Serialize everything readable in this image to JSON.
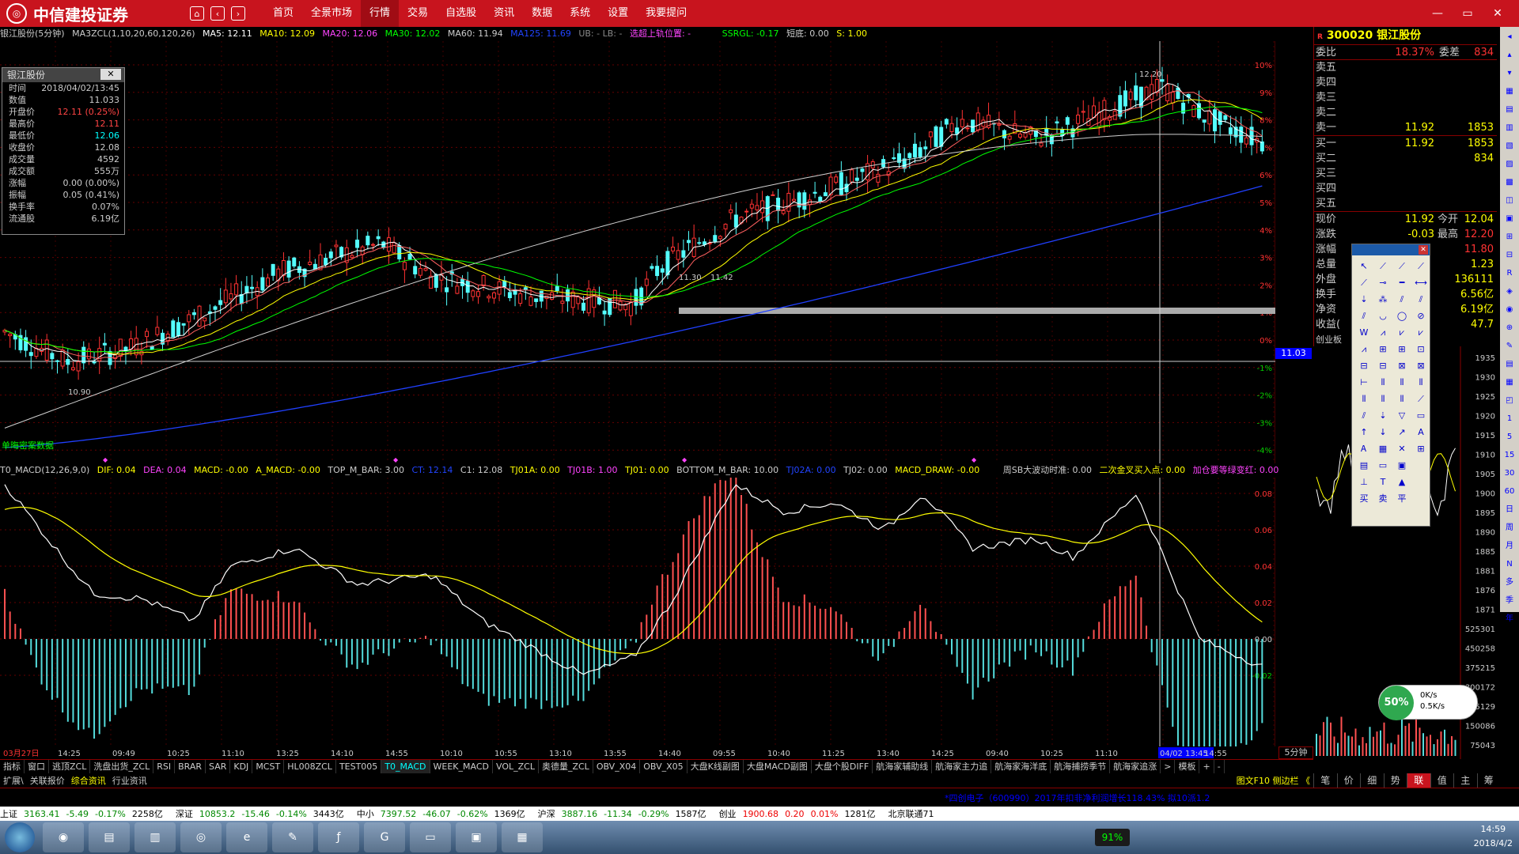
{
  "app": {
    "brand": "中信建投证券",
    "menu": [
      "首页",
      "全景市场",
      "行情",
      "交易",
      "自选股",
      "资讯",
      "数据",
      "系统",
      "设置",
      "我要提问"
    ],
    "active_menu": "行情",
    "window_controls": [
      "—",
      "▭",
      "✕"
    ]
  },
  "stock": {
    "code": "300020",
    "name": "银江股份",
    "period_title": "银江股份(5分钟)",
    "ma_params": "MA3ZCL(1,10,20,60,120,26)",
    "ma5": "MA5: 12.11",
    "ma10": "MA10: 12.09",
    "ma20": "MA20: 12.06",
    "ma30": "MA30: 12.02",
    "ma60": "MA60: 11.94",
    "ma125": "MA125: 11.69",
    "ub_lb": "UB: - LB: -",
    "pressure": "选超上轨位置: -",
    "ssrgl": "SSRGL: -0.17",
    "short": "短底: 0.00",
    "s": "S: 1.00",
    "zero_left": "0",
    "zero_right": "0"
  },
  "macd_line": {
    "title": "T0_MACD(12,26,9,0)",
    "dif": "DIF: 0.04",
    "dea": "DEA: 0.04",
    "macd": "MACD: -0.00",
    "a_macd": "A_MACD: -0.00",
    "top_bar": "TOP_M_BAR: 3.00",
    "ct": "CT: 12.14",
    "c1": "C1: 12.08",
    "tj01a": "TJ01A: 0.00",
    "tj01b": "TJ01B: 1.00",
    "tj01": "TJ01: 0.00",
    "bottom_bar": "BOTTOM_M_BAR: 10.00",
    "tj02a": "TJ02A: 0.00",
    "tj02": "TJ02: 0.00",
    "macd_draw": "MACD_DRAW: -0.00",
    "zhou": "周SB大波动时准: 0.00",
    "erci": "二次金叉买入点: 0.00",
    "jiacang": "加仓要等绿变红: 0.00"
  },
  "info_box": {
    "title": "银江股份",
    "rows": [
      {
        "k": "时间",
        "v": "2018/04/02/13:45",
        "c": "#ccc"
      },
      {
        "k": "数值",
        "v": "11.033",
        "c": "#ccc"
      },
      {
        "k": "开盘价",
        "v": "12.11 (0.25%)",
        "c": "#f44"
      },
      {
        "k": "最高价",
        "v": "12.11",
        "c": "#f44"
      },
      {
        "k": "最低价",
        "v": "12.06",
        "c": "#0ff"
      },
      {
        "k": "收盘价",
        "v": "12.08",
        "c": "#ccc"
      },
      {
        "k": "成交量",
        "v": "4592",
        "c": "#ccc"
      },
      {
        "k": "成交额",
        "v": "555万",
        "c": "#ccc"
      },
      {
        "k": "涨幅",
        "v": "0.00 (0.00%)",
        "c": "#ccc"
      },
      {
        "k": "振幅",
        "v": "0.05 (0.41%)",
        "c": "#ccc"
      },
      {
        "k": "换手率",
        "v": "0.07%",
        "c": "#ccc"
      },
      {
        "k": "流通股",
        "v": "6.19亿",
        "c": "#ccc"
      }
    ]
  },
  "order_book": {
    "weibi_label": "委比",
    "weibi": "18.37%",
    "weicha_label": "委差",
    "weicha": "834",
    "sells": [
      "卖五",
      "卖四",
      "卖三",
      "卖二",
      "卖一"
    ],
    "sell1_price": "11.92",
    "sell1_vol": "1853",
    "buys": [
      "买一",
      "买二",
      "买三",
      "买四",
      "买五"
    ],
    "buy1_price": "11.92",
    "buy1_vol": "1853",
    "buy2_vol": "834",
    "quote": [
      {
        "l": "现价",
        "v": "11.92",
        "l2": "今开",
        "v2": "12.04"
      },
      {
        "l": "涨跌",
        "v": "-0.03",
        "l2": "最高",
        "v2": "12.20"
      },
      {
        "l": "涨幅",
        "v": "",
        "l2": "",
        "v2": "11.80"
      },
      {
        "l": "总量",
        "v": "",
        "l2": "",
        "v2": "1.23"
      },
      {
        "l": "外盘",
        "v": "",
        "l2": "",
        "v2": "136111"
      },
      {
        "l": "换手",
        "v": "",
        "l2": "",
        "v2": "6.56亿"
      },
      {
        "l": "净资",
        "v": "",
        "l2": "",
        "v2": "6.19亿"
      },
      {
        "l": "收益(",
        "v": "",
        "l2": "",
        "v2": "47.7"
      }
    ],
    "board": "创业板"
  },
  "main_axis": {
    "right_pct": [
      "10%",
      "9%",
      "8%",
      "7%",
      "6%",
      "5%",
      "4%",
      "3%",
      "2%",
      "1%",
      "0%",
      "-1%",
      "-2%",
      "-3%",
      "-4%"
    ],
    "price_tag": "11.03",
    "annotations": [
      "12.20",
      "11.30",
      "11.42",
      "10.90"
    ],
    "left_caption": "单晦密案数据"
  },
  "macd_axis": [
    "0.08",
    "0.06",
    "0.04",
    "0.02",
    "0.00",
    "-0.02"
  ],
  "time_axis": [
    "03月27日",
    "14:25",
    "09:49",
    "10:25",
    "11:10",
    "13:25",
    "14:10",
    "14:55",
    "10:10",
    "10:55",
    "13:10",
    "13:55",
    "14:40",
    "09:55",
    "10:40",
    "11:25",
    "13:40",
    "14:25",
    "09:40",
    "10:25",
    "11:10",
    "04/02 13:45",
    "14:55"
  ],
  "period_button": "5分钟",
  "right_axis": [
    "1935",
    "1930",
    "1925",
    "1920",
    "1915",
    "1910",
    "1905",
    "1900",
    "1895",
    "1890",
    "1885",
    "1881",
    "1876",
    "1871",
    "525301",
    "450258",
    "375215",
    "300172",
    "225129",
    "150086",
    "75043"
  ],
  "tabs": [
    "指标",
    "窗口",
    "逃顶ZCL",
    "洗盘出货_ZCL",
    "RSI",
    "BRAR",
    "SAR",
    "KDJ",
    "MCST",
    "HL008ZCL",
    "TEST005",
    "T0_MACD",
    "WEEK_MACD",
    "VOL_ZCL",
    "奥德量_ZCL",
    "OBV_X04",
    "OBV_X05",
    "大盘K线副图",
    "大盘MACD副图",
    "大盘个股DIFF",
    "航海家辅助线",
    "航海家主力追",
    "航海家海洋底",
    "航海捕捞季节",
    "航海家追涨",
    ">",
    "模板",
    "+",
    "-"
  ],
  "active_tab": "T0_MACD",
  "tabs2": [
    "扩展\\",
    "关联报价",
    "综合资讯",
    "行业资讯"
  ],
  "tabs2_right": "图文F10 侧边栏 《",
  "right_tabs": [
    "笔",
    "价",
    "细",
    "势",
    "联",
    "值",
    "主",
    "筹"
  ],
  "active_right_tab": "联",
  "ticker_news": "*四创电子（600990）2017年扣非净利润增长118.43% 拟10派1.2",
  "index_bar": [
    {
      "name": "上证",
      "val": "3163.41",
      "chg": "-5.49",
      "pct": "-0.17%",
      "amt": "2258亿"
    },
    {
      "name": "深证",
      "val": "10853.2",
      "chg": "-15.46",
      "pct": "-0.14%",
      "amt": "3443亿"
    },
    {
      "name": "中小",
      "val": "7397.52",
      "chg": "-46.07",
      "pct": "-0.62%",
      "amt": "1369亿"
    },
    {
      "name": "沪深",
      "val": "3887.16",
      "chg": "-11.34",
      "pct": "-0.29%",
      "amt": "1587亿"
    },
    {
      "name": "创业",
      "val": "1900.68",
      "chg": "0.20",
      "pct": "0.01%",
      "amt": "1281亿"
    }
  ],
  "broker": "北京联通71",
  "network": {
    "pct": "50%",
    "up": "0K/s",
    "down": "0.5K/s"
  },
  "battery": "91%",
  "clock": {
    "time": "14:59",
    "date": "2018/4/2"
  },
  "colors": {
    "brand": "#c8141e",
    "up": "#ff3232",
    "down": "#54ffff",
    "ma5": "#ffffff",
    "ma10": "#ffff00",
    "ma20": "#ff44ff",
    "ma30": "#00ff00",
    "ma60": "#d0d0d0",
    "ma125": "#2040ff"
  }
}
